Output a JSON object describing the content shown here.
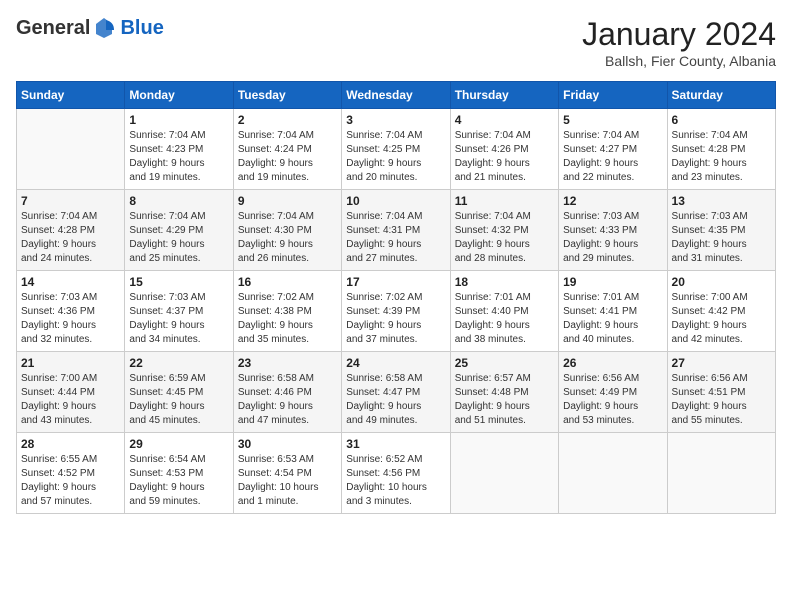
{
  "logo": {
    "general": "General",
    "blue": "Blue"
  },
  "header": {
    "month_year": "January 2024",
    "location": "Ballsh, Fier County, Albania"
  },
  "days_of_week": [
    "Sunday",
    "Monday",
    "Tuesday",
    "Wednesday",
    "Thursday",
    "Friday",
    "Saturday"
  ],
  "weeks": [
    [
      {
        "day": "",
        "info": ""
      },
      {
        "day": "1",
        "info": "Sunrise: 7:04 AM\nSunset: 4:23 PM\nDaylight: 9 hours\nand 19 minutes."
      },
      {
        "day": "2",
        "info": "Sunrise: 7:04 AM\nSunset: 4:24 PM\nDaylight: 9 hours\nand 19 minutes."
      },
      {
        "day": "3",
        "info": "Sunrise: 7:04 AM\nSunset: 4:25 PM\nDaylight: 9 hours\nand 20 minutes."
      },
      {
        "day": "4",
        "info": "Sunrise: 7:04 AM\nSunset: 4:26 PM\nDaylight: 9 hours\nand 21 minutes."
      },
      {
        "day": "5",
        "info": "Sunrise: 7:04 AM\nSunset: 4:27 PM\nDaylight: 9 hours\nand 22 minutes."
      },
      {
        "day": "6",
        "info": "Sunrise: 7:04 AM\nSunset: 4:28 PM\nDaylight: 9 hours\nand 23 minutes."
      }
    ],
    [
      {
        "day": "7",
        "info": "Sunrise: 7:04 AM\nSunset: 4:28 PM\nDaylight: 9 hours\nand 24 minutes."
      },
      {
        "day": "8",
        "info": "Sunrise: 7:04 AM\nSunset: 4:29 PM\nDaylight: 9 hours\nand 25 minutes."
      },
      {
        "day": "9",
        "info": "Sunrise: 7:04 AM\nSunset: 4:30 PM\nDaylight: 9 hours\nand 26 minutes."
      },
      {
        "day": "10",
        "info": "Sunrise: 7:04 AM\nSunset: 4:31 PM\nDaylight: 9 hours\nand 27 minutes."
      },
      {
        "day": "11",
        "info": "Sunrise: 7:04 AM\nSunset: 4:32 PM\nDaylight: 9 hours\nand 28 minutes."
      },
      {
        "day": "12",
        "info": "Sunrise: 7:03 AM\nSunset: 4:33 PM\nDaylight: 9 hours\nand 29 minutes."
      },
      {
        "day": "13",
        "info": "Sunrise: 7:03 AM\nSunset: 4:35 PM\nDaylight: 9 hours\nand 31 minutes."
      }
    ],
    [
      {
        "day": "14",
        "info": "Sunrise: 7:03 AM\nSunset: 4:36 PM\nDaylight: 9 hours\nand 32 minutes."
      },
      {
        "day": "15",
        "info": "Sunrise: 7:03 AM\nSunset: 4:37 PM\nDaylight: 9 hours\nand 34 minutes."
      },
      {
        "day": "16",
        "info": "Sunrise: 7:02 AM\nSunset: 4:38 PM\nDaylight: 9 hours\nand 35 minutes."
      },
      {
        "day": "17",
        "info": "Sunrise: 7:02 AM\nSunset: 4:39 PM\nDaylight: 9 hours\nand 37 minutes."
      },
      {
        "day": "18",
        "info": "Sunrise: 7:01 AM\nSunset: 4:40 PM\nDaylight: 9 hours\nand 38 minutes."
      },
      {
        "day": "19",
        "info": "Sunrise: 7:01 AM\nSunset: 4:41 PM\nDaylight: 9 hours\nand 40 minutes."
      },
      {
        "day": "20",
        "info": "Sunrise: 7:00 AM\nSunset: 4:42 PM\nDaylight: 9 hours\nand 42 minutes."
      }
    ],
    [
      {
        "day": "21",
        "info": "Sunrise: 7:00 AM\nSunset: 4:44 PM\nDaylight: 9 hours\nand 43 minutes."
      },
      {
        "day": "22",
        "info": "Sunrise: 6:59 AM\nSunset: 4:45 PM\nDaylight: 9 hours\nand 45 minutes."
      },
      {
        "day": "23",
        "info": "Sunrise: 6:58 AM\nSunset: 4:46 PM\nDaylight: 9 hours\nand 47 minutes."
      },
      {
        "day": "24",
        "info": "Sunrise: 6:58 AM\nSunset: 4:47 PM\nDaylight: 9 hours\nand 49 minutes."
      },
      {
        "day": "25",
        "info": "Sunrise: 6:57 AM\nSunset: 4:48 PM\nDaylight: 9 hours\nand 51 minutes."
      },
      {
        "day": "26",
        "info": "Sunrise: 6:56 AM\nSunset: 4:49 PM\nDaylight: 9 hours\nand 53 minutes."
      },
      {
        "day": "27",
        "info": "Sunrise: 6:56 AM\nSunset: 4:51 PM\nDaylight: 9 hours\nand 55 minutes."
      }
    ],
    [
      {
        "day": "28",
        "info": "Sunrise: 6:55 AM\nSunset: 4:52 PM\nDaylight: 9 hours\nand 57 minutes."
      },
      {
        "day": "29",
        "info": "Sunrise: 6:54 AM\nSunset: 4:53 PM\nDaylight: 9 hours\nand 59 minutes."
      },
      {
        "day": "30",
        "info": "Sunrise: 6:53 AM\nSunset: 4:54 PM\nDaylight: 10 hours\nand 1 minute."
      },
      {
        "day": "31",
        "info": "Sunrise: 6:52 AM\nSunset: 4:56 PM\nDaylight: 10 hours\nand 3 minutes."
      },
      {
        "day": "",
        "info": ""
      },
      {
        "day": "",
        "info": ""
      },
      {
        "day": "",
        "info": ""
      }
    ]
  ]
}
